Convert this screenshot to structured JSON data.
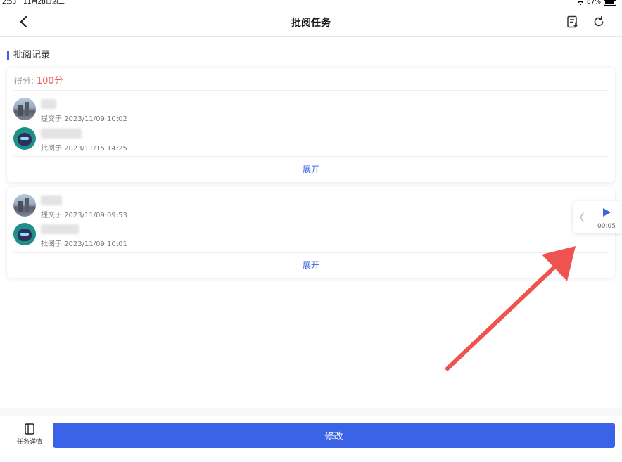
{
  "status_bar": {
    "time": "2:53",
    "date": "11月28日周二",
    "battery": "87%"
  },
  "nav": {
    "title": "批阅任务"
  },
  "section_title": "批阅记录",
  "cards": [
    {
      "score_label": "得分:",
      "score_value": "100分",
      "records": [
        {
          "role": "student",
          "meta": "提交于 2023/11/09 10:02"
        },
        {
          "role": "teacher",
          "meta": "批阅于 2023/11/15 14:25"
        }
      ],
      "expand_label": "展开"
    },
    {
      "records": [
        {
          "role": "student",
          "meta": "提交于 2023/11/09 09:53"
        },
        {
          "role": "teacher",
          "meta": "批阅于 2023/11/09 10:01"
        }
      ],
      "expand_label": "展开"
    }
  ],
  "audio": {
    "time": "00:05"
  },
  "bottom": {
    "task_details_label": "任务详情",
    "modify_label": "修改"
  },
  "colors": {
    "accent": "#3b63e8",
    "score": "#f25c54",
    "arrow": "#ef5350"
  }
}
